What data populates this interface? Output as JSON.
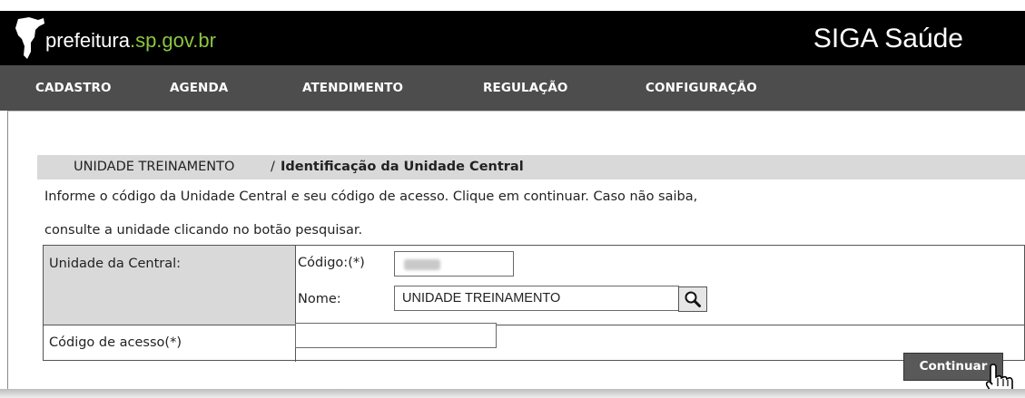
{
  "header": {
    "logo_text_main": "prefeitura",
    "logo_text_accent": ".sp.gov.br",
    "app_title": "SIGA Saúde",
    "logo_icon": "sao-paulo-map-icon"
  },
  "nav": {
    "items": [
      "CADASTRO",
      "AGENDA",
      "ATENDIMENTO",
      "REGULAÇÃO",
      "CONFIGURAÇÃO"
    ]
  },
  "breadcrumb": {
    "parent": "UNIDADE TREINAMENTO",
    "separator": "/",
    "current": "Identificação da Unidade Central"
  },
  "instructions": {
    "line1": "Informe o código da Unidade Central e seu código de acesso. Clique em continuar. Caso não saiba,",
    "line2": "consulte a unidade clicando no botão pesquisar."
  },
  "form": {
    "unit_label": "Unidade da Central:",
    "code_label": "Código:(*)",
    "code_value": "",
    "name_label": "Nome:",
    "name_value": "UNIDADE TREINAMENTO",
    "search_icon": "magnifier-icon",
    "access_label": "Código de acesso(*)",
    "access_value": ""
  },
  "actions": {
    "continue_label": "Continuar",
    "cursor_icon": "hand-pointer-icon"
  },
  "colors": {
    "header_bg": "#000000",
    "logo_accent": "#8cc63f",
    "nav_bg": "#4d4d4d",
    "breadcrumb_bg": "#d9d9d9",
    "button_bg": "#595959"
  }
}
